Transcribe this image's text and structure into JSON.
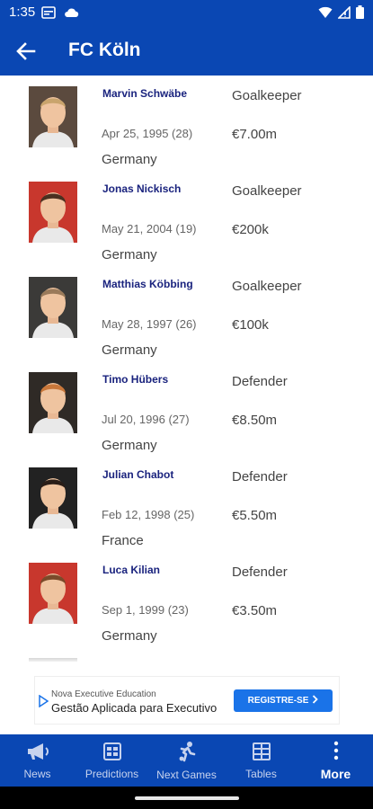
{
  "status_bar": {
    "time": "1:35"
  },
  "app_bar": {
    "title": "FC Köln"
  },
  "players": [
    {
      "name": "Marvin Schwäbe",
      "dob": "Apr 25, 1995 (28)",
      "nationality": "Germany",
      "position": "Goalkeeper",
      "value": "€7.00m",
      "avatar_bg": "#5b4a3e",
      "hair": "#c9a46d"
    },
    {
      "name": "Jonas Nickisch",
      "dob": "May 21, 2004 (19)",
      "nationality": "Germany",
      "position": "Goalkeeper",
      "value": "€200k",
      "avatar_bg": "#c8372d",
      "hair": "#4a3020"
    },
    {
      "name": "Matthias Köbbing",
      "dob": "May 28, 1997 (26)",
      "nationality": "Germany",
      "position": "Goalkeeper",
      "value": "€100k",
      "avatar_bg": "#3b3a38",
      "hair": "#9a7a5a"
    },
    {
      "name": "Timo Hübers",
      "dob": "Jul 20, 1996 (27)",
      "nationality": "Germany",
      "position": "Defender",
      "value": "€8.50m",
      "avatar_bg": "#2f2a26",
      "hair": "#c9773a"
    },
    {
      "name": "Julian Chabot",
      "dob": "Feb 12, 1998 (25)",
      "nationality": "France",
      "position": "Defender",
      "value": "€5.50m",
      "avatar_bg": "#222222",
      "hair": "#2a1e18"
    },
    {
      "name": "Luca Kilian",
      "dob": "Sep 1, 1999 (23)",
      "nationality": "Germany",
      "position": "Defender",
      "value": "€3.50m",
      "avatar_bg": "#c8372d",
      "hair": "#7a4a2a"
    }
  ],
  "ad": {
    "brand": "Nova Executive Education",
    "headline": "Gestão Aplicada para Executivo",
    "cta": "REGISTRE-SE"
  },
  "bottom_nav": [
    {
      "label": "News",
      "icon": "megaphone-icon"
    },
    {
      "label": "Predictions",
      "icon": "predictions-icon"
    },
    {
      "label": "Next Games",
      "icon": "player-running-icon"
    },
    {
      "label": "Tables",
      "icon": "table-grid-icon"
    },
    {
      "label": "More",
      "icon": "more-vertical-icon"
    }
  ],
  "colors": {
    "primary": "#0a47b3",
    "name": "#1a237e",
    "cta": "#1a73e8"
  }
}
